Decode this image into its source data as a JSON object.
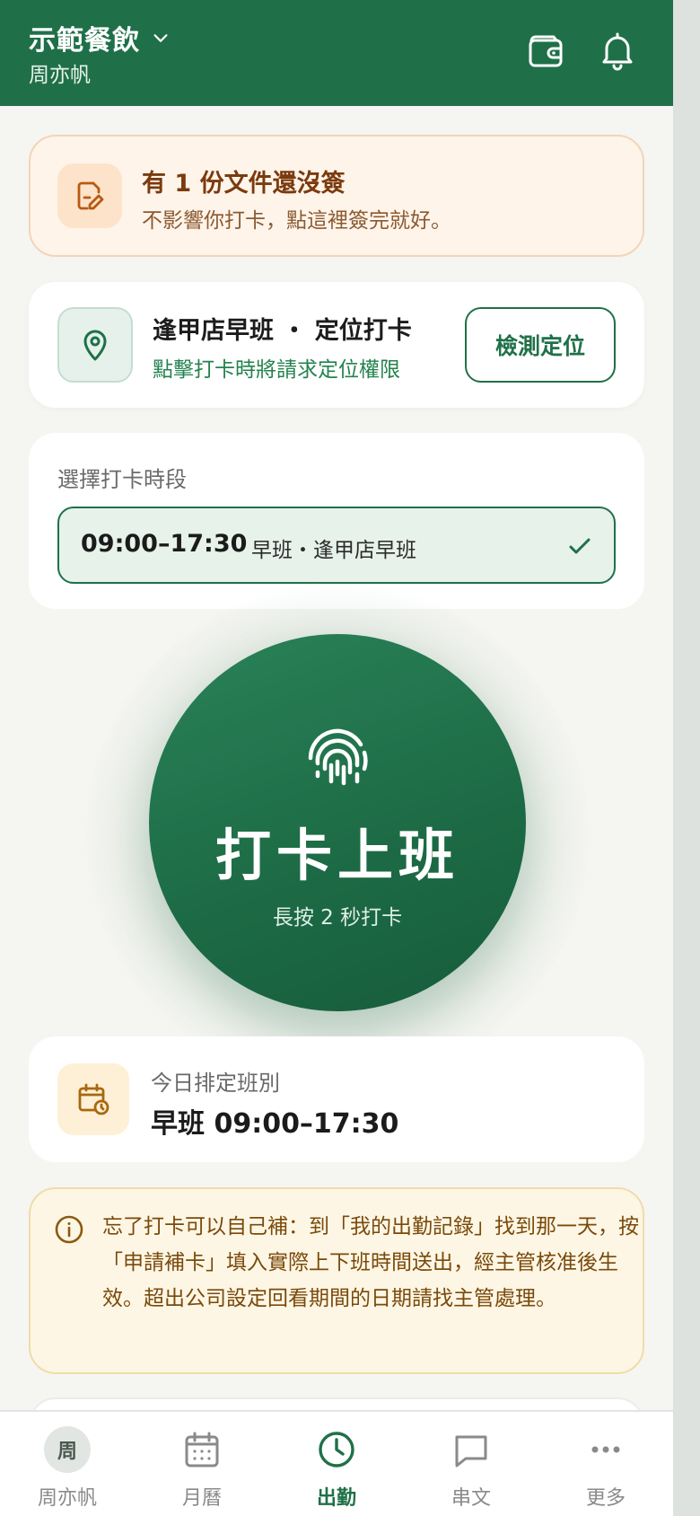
{
  "header": {
    "org_name": "示範餐飲",
    "user_name": "周亦帆"
  },
  "doc_notice": {
    "title": "有 1 份文件還沒簽",
    "subtitle": "不影響你打卡，點這裡簽完就好。"
  },
  "location": {
    "title": "逢甲店早班 ・ 定位打卡",
    "subtitle": "點擊打卡時將請求定位權限",
    "button_label": "檢測定位"
  },
  "shift_select": {
    "label": "選擇打卡時段",
    "selected_time": "09:00–17:30",
    "selected_name": "早班・逢甲店早班"
  },
  "punch": {
    "title": "打卡上班",
    "hint": "長按 2 秒打卡"
  },
  "today": {
    "label": "今日排定班別",
    "value": "早班 09:00–17:30"
  },
  "tip": {
    "text": "忘了打卡可以自己補：到「我的出勤記錄」找到那一天，按「申請補卡」填入實際上下班時間送出，經主管核准後生效。超出公司設定回看期間的日期請找主管處理。"
  },
  "nav": {
    "items": [
      {
        "label": "周亦帆",
        "avatar_text": "周",
        "icon": "avatar"
      },
      {
        "label": "月曆",
        "icon": "calendar-icon"
      },
      {
        "label": "出勤",
        "icon": "clock-icon",
        "active": true
      },
      {
        "label": "串文",
        "icon": "chat-icon"
      },
      {
        "label": "更多",
        "icon": "more-icon"
      }
    ]
  },
  "colors": {
    "primary": "#1f7048",
    "background": "#f5f5f1",
    "warning_bg": "#fff4ea",
    "tip_bg": "#fef6e4"
  }
}
